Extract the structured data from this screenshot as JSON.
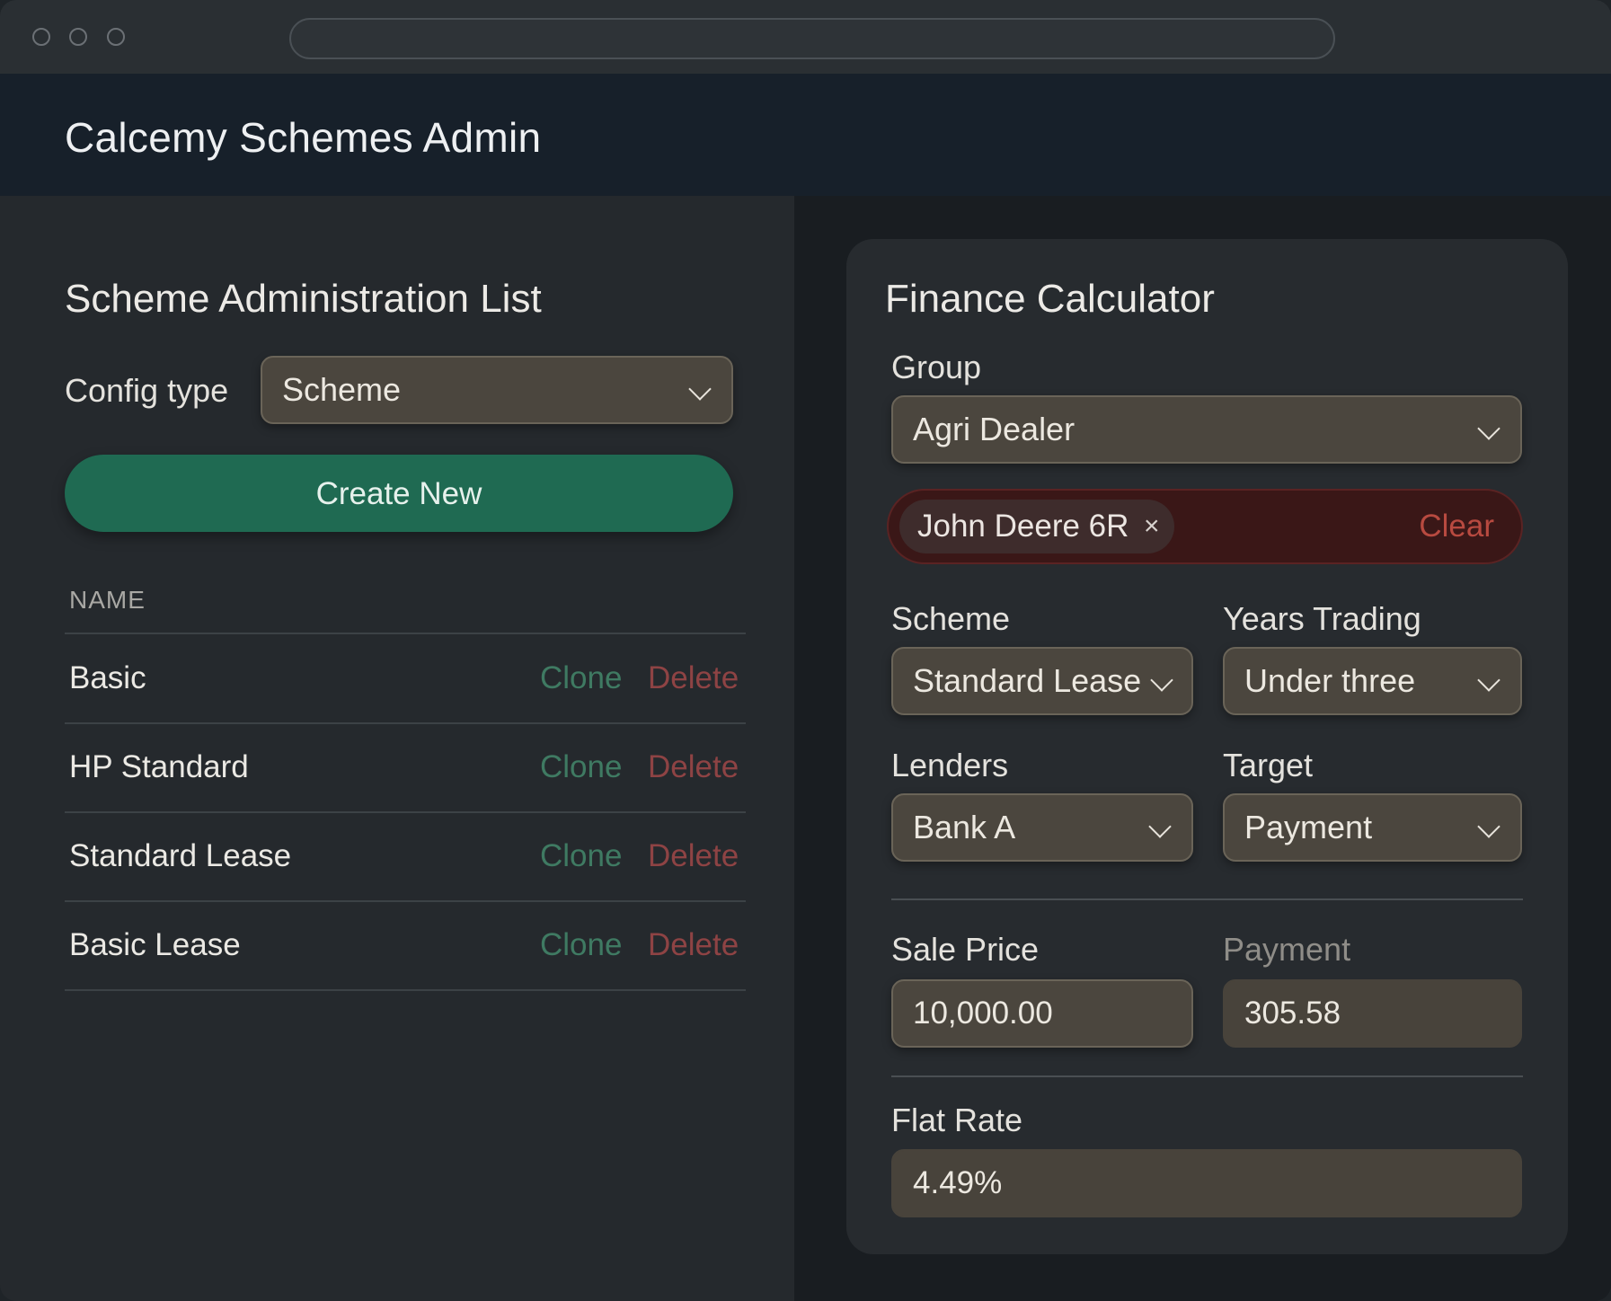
{
  "app": {
    "title": "Calcemy Schemes Admin"
  },
  "admin": {
    "heading": "Scheme Administration List",
    "config_type_label": "Config type",
    "config_type_value": "Scheme",
    "create_label": "Create New",
    "column_name": "NAME",
    "clone_label": "Clone",
    "delete_label": "Delete",
    "rows": [
      "Basic",
      "HP Standard",
      "Standard Lease",
      "Basic Lease"
    ]
  },
  "calculator": {
    "heading": "Finance Calculator",
    "group_label": "Group",
    "group_value": "Agri Dealer",
    "chip_label": "John Deere 6R",
    "chip_remove": "×",
    "clear_label": "Clear",
    "scheme_label": "Scheme",
    "scheme_value": "Standard Lease",
    "years_label": "Years Trading",
    "years_value": "Under three",
    "lenders_label": "Lenders",
    "lenders_value": "Bank A",
    "target_label": "Target",
    "target_value": "Payment",
    "sale_price_label": "Sale Price",
    "sale_price_value": "10,000.00",
    "payment_label": "Payment",
    "payment_value": "305.58",
    "flat_rate_label": "Flat Rate",
    "flat_rate_value": "4.49%"
  },
  "colors": {
    "accent_green": "#1f6a52",
    "clone_green": "#3f7a62",
    "delete_red": "#8e4344",
    "clear_red": "#b84a40"
  }
}
